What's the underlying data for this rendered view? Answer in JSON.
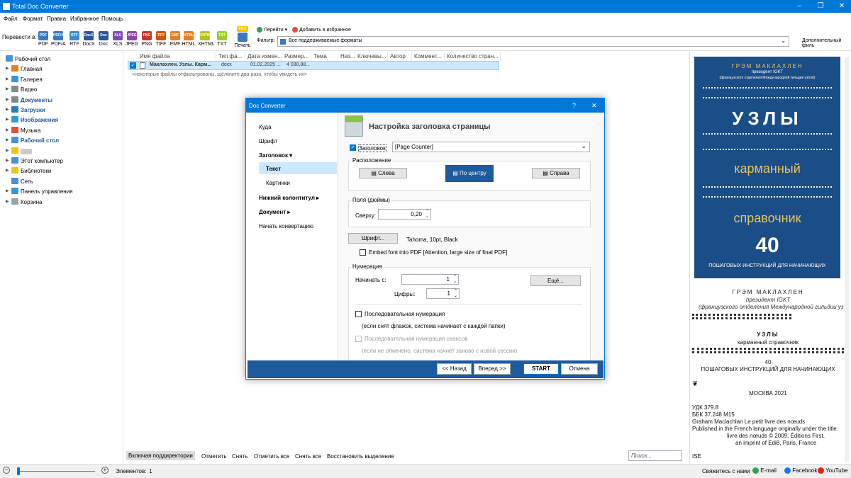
{
  "window": {
    "title": "Total Doc Converter"
  },
  "menu": [
    "Файл",
    "Формат",
    "Правка",
    "Избранное",
    "Помощь"
  ],
  "toolbar": {
    "convert_label": "Перевести в:",
    "formats": [
      {
        "label": "PDF",
        "color": "#3a78c2"
      },
      {
        "label": "PDF/A",
        "color": "#3a78c2"
      },
      {
        "label": "RTF",
        "color": "#3c8ad3"
      },
      {
        "label": "DocX",
        "color": "#2b579a"
      },
      {
        "label": "Doc",
        "color": "#2b579a"
      },
      {
        "label": "XLS",
        "color": "#7a4bb8"
      },
      {
        "label": "JPEG",
        "color": "#8e44ad"
      },
      {
        "label": "PNG",
        "color": "#c0392b"
      },
      {
        "label": "TIFF",
        "color": "#d35400"
      },
      {
        "label": "EMF",
        "color": "#e67e22"
      },
      {
        "label": "HTML",
        "color": "#e67e22"
      },
      {
        "label": "XHTML",
        "color": "#b5c21f"
      },
      {
        "label": "TXT",
        "color": "#9acd32"
      }
    ],
    "print_label": "Печать",
    "pro_badge": "PRO",
    "goto_label": "Перейти",
    "favorite_label": "Добавить в избранное",
    "filter_label": "Фильтр:",
    "filter_value": "Все поддерживаемые форматы",
    "extra_label": "Дополнительный филь"
  },
  "tree": [
    {
      "label": "Рабочий стол",
      "color": "#4a90d9",
      "bold": false,
      "arrow": false
    },
    {
      "label": "Главная",
      "color": "#e67e22",
      "bold": false,
      "arrow": true
    },
    {
      "label": "Галерея",
      "color": "#3498db",
      "bold": false,
      "arrow": true
    },
    {
      "label": "Видео",
      "color": "#7f8c8d",
      "bold": false,
      "arrow": true
    },
    {
      "label": "Документы",
      "color": "#7f8c8d",
      "bold": true,
      "arrow": true
    },
    {
      "label": "Загрузки",
      "color": "#2980b9",
      "bold": true,
      "arrow": true
    },
    {
      "label": "Изображения",
      "color": "#3498db",
      "bold": true,
      "arrow": true
    },
    {
      "label": "Музыка",
      "color": "#e74c3c",
      "bold": false,
      "arrow": true
    },
    {
      "label": "Рабочий стол",
      "color": "#4a90d9",
      "bold": true,
      "arrow": true
    },
    {
      "label": "",
      "color": "#f1c40f",
      "bold": false,
      "arrow": true
    },
    {
      "label": "Этот компьютер",
      "color": "#4a90d9",
      "bold": false,
      "arrow": true
    },
    {
      "label": "Библиотеки",
      "color": "#f1c40f",
      "bold": false,
      "arrow": true
    },
    {
      "label": "Сеть",
      "color": "#4a90d9",
      "bold": false,
      "arrow": false
    },
    {
      "label": "Панель управления",
      "color": "#3498db",
      "bold": false,
      "arrow": true
    },
    {
      "label": "Корзина",
      "color": "#95a5a6",
      "bold": false,
      "arrow": true
    }
  ],
  "columns": [
    "Имя файла",
    "Тип фа...",
    "Дата измен...",
    "Размер...",
    "Тема",
    "Наз...",
    "Ключевы...",
    "Автор",
    "Коммент...",
    "Количество стран..."
  ],
  "file": {
    "name": "Маклахлен. Узлы. Карм...",
    "type": "docx",
    "date": "01.02.2025 ...",
    "size": "4 030,88..."
  },
  "filtered_note": "<некоторые файлы отфильтрованы, щёлкните два раза, чтобы увидеть их>",
  "bottom_tabs": [
    "Включая поддиректории",
    "Отметить",
    "Снять",
    "Отметить все",
    "Снять все",
    "Восстановить выделение"
  ],
  "search_placeholder": "Поиск...",
  "status": {
    "items_label": "Элементов:",
    "items_count": "1",
    "contact": "Свяжитесь с нами",
    "email": "E-mail",
    "facebook": "Facebook",
    "youtube": "YouTube"
  },
  "dialog": {
    "title": "Doc Converter",
    "help": "?",
    "close": "✕",
    "nav": [
      "Куда",
      "Шрифт",
      "Заголовок ▾",
      "Текст",
      "Картинки",
      "Нижний колонтитул ▸",
      "Документ ▸",
      "Начать конвертацию"
    ],
    "heading": "Настройка заголовка страницы",
    "header_checkbox_label": "Заголовок",
    "header_value": "[Page Counter]",
    "position_label": "Расположение",
    "pos_left": "Слева",
    "pos_center": "По центру",
    "pos_right": "Справа",
    "margins_label": "Поля (дюймы)",
    "top_label": "Сверху:",
    "top_value": "0,20",
    "font_button": "Шрифт...",
    "font_value": "Tahoma, 10pt, Black",
    "embed_label": "Embed font into PDF  [Attention, large size of final PDF]",
    "numbering_label": "Нумерация",
    "start_label": "Начинать с:",
    "start_value": "1",
    "digits_label": "Цифры:",
    "digits_value": "1",
    "more_button": "Ещё...",
    "sequential_label": "Последовательная нумерация",
    "sequential_note": "(если снят флажок, система начинает с каждой папки)",
    "session_label": "Последовательная нумерация сеансов",
    "session_note": "(если не отмечено, система начнет заново с новой сессии)",
    "back": "<< Назад",
    "next": "Вперед >>",
    "start": "START",
    "cancel": "Отмена"
  },
  "preview": {
    "cover_author": "ГРЭМ МАКЛАХЛЕН",
    "cover_sub1": "президент IGKT",
    "cover_sub2": "(французского отделения Международной гильдии узлов)",
    "cover_title": "УЗЛЫ",
    "cover_word1": "карманный",
    "cover_word2": "справочник",
    "cover_num": "40",
    "cover_bottom": "ПОШАГОВЫХ ИНСТРУКЦИЙ ДЛЯ НАЧИНАЮЩИХ",
    "p_author": "ГРЭМ МАКЛАХЛЕН",
    "p_sub1": "президент IGKT",
    "p_sub2": "(французского отделения Международной гильдии уз",
    "p_title": "УЗЛЫ",
    "p_sub3": "карманный справочник",
    "p_num": "40",
    "p_steps": "ПОШАГОВЫХ ИНСТРУКЦИЙ ДЛЯ НАЧИНАЮЩИХ",
    "p_city": "МОСКВА 2021",
    "p_udk": "УДК 379.8",
    "p_bbk": "ББК 37.248 М15",
    "p_orig": "Graham Maclachlan Le petit livre des nœuds",
    "p_pub": "Published in the French language originally under the title:",
    "p_pub2": "livre des nœuds © 2009, Éditions First,",
    "p_pub3": "an imprint of Edi8, Paris, France",
    "p_isb": "ISE"
  }
}
